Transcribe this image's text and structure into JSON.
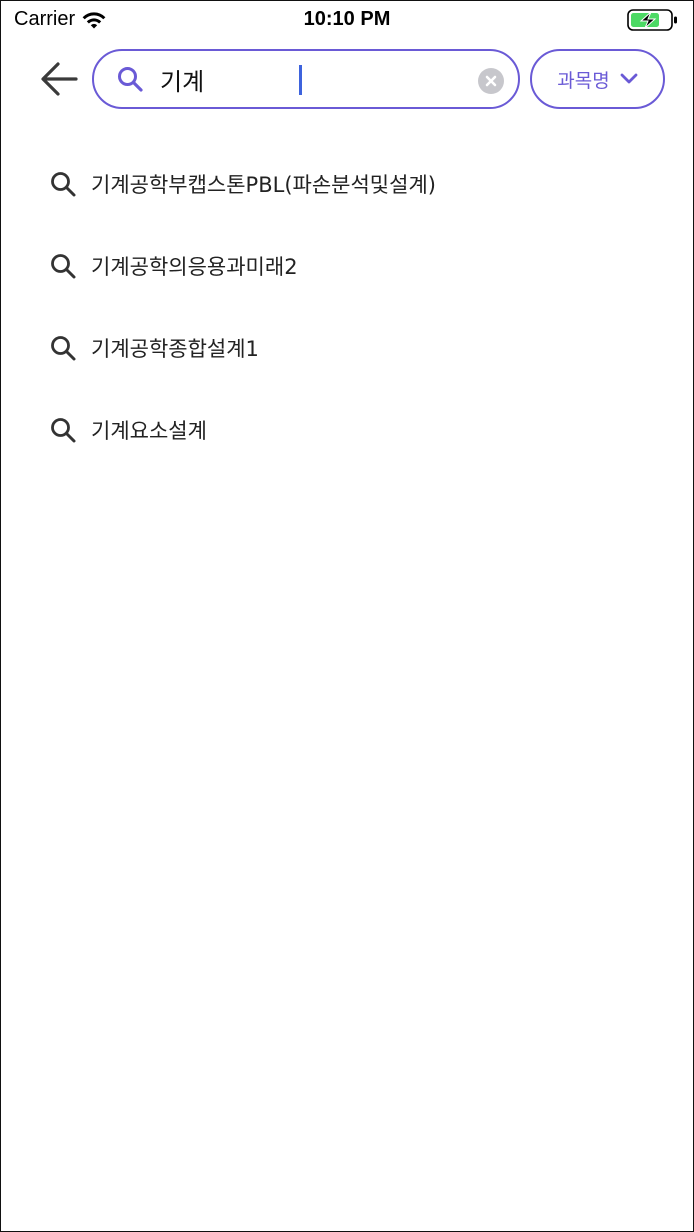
{
  "status_bar": {
    "carrier": "Carrier",
    "time": "10:10 PM",
    "wifi_icon": "wifi-icon",
    "battery_icon": "battery-charging-icon",
    "battery_color": "#4cd964"
  },
  "search": {
    "back_icon": "arrow-left-icon",
    "search_icon": "search-icon",
    "query": "기계",
    "clear_icon": "clear-circle-icon",
    "filter_label": "과목명",
    "filter_icon": "chevron-down-icon",
    "accent_color": "#6a5ad6"
  },
  "suggestions": [
    {
      "label": "기계공학부캡스톤PBL(파손분석및설계)"
    },
    {
      "label": "기계공학의응용과미래2"
    },
    {
      "label": "기계공학종합설계1"
    },
    {
      "label": "기계요소설계"
    }
  ]
}
